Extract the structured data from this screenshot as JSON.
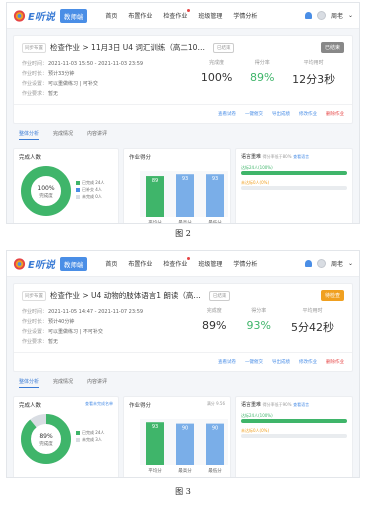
{
  "brand": {
    "logo_text": "E听说",
    "badge": "教师端"
  },
  "nav": [
    "首页",
    "布置作业",
    "检查作业",
    "班级管理",
    "学情分析"
  ],
  "user": {
    "name": "周老"
  },
  "screens": [
    {
      "caption": "图 2",
      "tag": "同步布置",
      "title": "检查作业 > 11月3日 U4 词汇训练（高二10…",
      "status": "已结束",
      "state_btn": "已结束",
      "time_label": "作业时间：",
      "time": "2021-11-03 15:50 - 2021-11-03 23:59",
      "dur_label": "作业时长：",
      "dur": "预计33分钟",
      "redo_label": "作业设置：",
      "redo": "可以重做练习 | 可补交",
      "ans_label": "作业要求：",
      "ans": "暂无",
      "stats": [
        {
          "label": "完成度",
          "value": "100%"
        },
        {
          "label": "得分率",
          "value": "89%"
        },
        {
          "label": "平均用时",
          "value": "12分3秒"
        }
      ],
      "actions": [
        "查看试卷",
        "一键催交",
        "导出成绩",
        "修改作业",
        "删除作业"
      ],
      "tabs": [
        "整体分析",
        "完成情况",
        "内容讲评"
      ],
      "donut": {
        "title": "完成人数",
        "center_pct": "100%",
        "center_txt": "完成度",
        "legend": [
          "已完成 24人",
          "已补交 4人",
          "未完成 0人"
        ]
      },
      "bars": {
        "title": "作业得分",
        "values": [
          89,
          93,
          93
        ],
        "labels": [
          "平均分",
          "最高分",
          "最低分"
        ],
        "value_labels": [
          "89",
          "93",
          "93"
        ]
      },
      "progress": {
        "title": "语言重难",
        "note": "得分率低于80%",
        "link": "查看语言",
        "items": [
          {
            "text": "达标24人(100%)",
            "pct": 100
          },
          {
            "text": "未达标0人(0%)",
            "pct": 0
          }
        ]
      },
      "accent": "#3fb56a"
    },
    {
      "caption": "图 3",
      "tag": "同步布置",
      "title": "检查作业 > U4 动物的肢体语言1 朗读（高…",
      "status": "已结束",
      "state_btn": "待检查",
      "time_label": "作业时间：",
      "time": "2021-11-05 14:47 - 2021-11-07 23:59",
      "dur_label": "作业时长：",
      "dur": "预计40分钟",
      "redo_label": "作业设置：",
      "redo": "可以重做练习 | 不可补交",
      "ans_label": "作业要求：",
      "ans": "暂无",
      "stats": [
        {
          "label": "完成度",
          "value": "89%"
        },
        {
          "label": "得分率",
          "value": "93%"
        },
        {
          "label": "平均用时",
          "value": "5分42秒"
        }
      ],
      "actions": [
        "查看试卷",
        "一键催交",
        "导出成绩",
        "修改作业",
        "删除作业"
      ],
      "tabs": [
        "整体分析",
        "完成情况",
        "内容讲评"
      ],
      "donut": {
        "title": "完成人数",
        "link": "查看未完成名单",
        "center_pct": "89%",
        "center_txt": "完成度",
        "legend": [
          "已完成 24人",
          "未完成 3人"
        ]
      },
      "bars": {
        "title": "作业得分",
        "extra": "满分 9.56",
        "values": [
          93,
          90,
          90
        ],
        "labels": [
          "平均分",
          "最高分",
          "最低分"
        ],
        "value_labels": [
          "93",
          "90",
          "90"
        ]
      },
      "progress": {
        "title": "语言重难",
        "note": "得分率低于90%",
        "link": "查看语言",
        "items": [
          {
            "text": "达标24人(100%)",
            "pct": 100
          },
          {
            "text": "未达标0人(0%)",
            "pct": 0
          }
        ]
      },
      "accent": "#3fb56a"
    }
  ],
  "colors": {
    "blue": "#4a8ee6",
    "green": "#3fb56a",
    "orange": "#f0a020",
    "red": "#e64545",
    "gray_state": "#888888"
  }
}
